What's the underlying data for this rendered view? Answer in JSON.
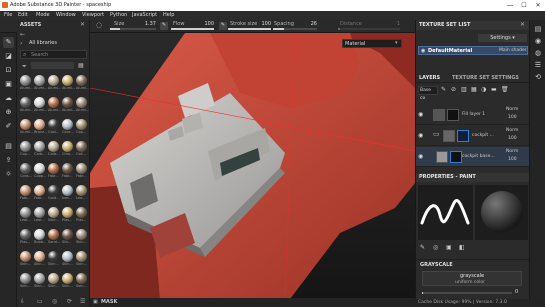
{
  "titlebar": {
    "title": "Adobe Substance 3D Painter - spaceship",
    "controls": [
      "—",
      "☐",
      "✕"
    ]
  },
  "menubar": {
    "items": [
      "File",
      "Edit",
      "Mode",
      "Window",
      "Viewport",
      "Python",
      "JavaScript",
      "Help"
    ]
  },
  "toolbar": {
    "size_label": "Size",
    "size_value": "1.37",
    "flow_label": "Flow",
    "flow_value": "100",
    "stroke_label": "Stroke size",
    "stroke_value": "100",
    "spacing_label": "Spacing",
    "spacing_value": "26",
    "distance_label": "Distance",
    "distance_value": "1"
  },
  "assets": {
    "title": "ASSETS",
    "library": "All libraries",
    "search_placeholder": "Search",
    "materials": [
      "Alumi...",
      "Alumi...",
      "Alumi...",
      "Alumi...",
      "Alumi...",
      "Alumi...",
      "Alumi...",
      "Alumi...",
      "Alumi...",
      "Alumi...",
      "Alumi...",
      "Bronz...",
      "Coal...",
      "Conc...",
      "Cop...",
      "Cop...",
      "Carb...",
      "Carb...",
      "Chro...",
      "Coll...",
      "Cons...",
      "Copp...",
      "Fabr...",
      "Fabr...",
      "Fabr...",
      "Fabr...",
      "Fabr...",
      "Gold...",
      "Iron...",
      "Lea...",
      "Leat...",
      "Leat...",
      "Nick...",
      "Plas...",
      "Plas...",
      "Plas...",
      "Rubb...",
      "Sand...",
      "Silv...",
      "Skin...",
      "Skin...",
      "Skin...",
      "Skin...",
      "Skin...",
      "Skin...",
      "Skin...",
      "Skin...",
      "Skin...",
      "Skin...",
      "Skin..."
    ]
  },
  "viewport": {
    "material_select": "Material",
    "mask_label": "MASK"
  },
  "texture_set_list": {
    "title": "TEXTURE SET LIST",
    "settings_label": "Settings",
    "item_name": "DefaultMaterial",
    "item_shader": "Main shader"
  },
  "layers": {
    "title": "LAYERS",
    "tab2": "TEXTURE SET SETTINGS",
    "channel": "Base co",
    "rows": [
      {
        "name": "Fill layer 1",
        "blend": "Norm",
        "opacity": "100"
      },
      {
        "name": "cockpit ...",
        "blend": "Norm",
        "opacity": "100"
      },
      {
        "name": "cockpit base...",
        "blend": "Norm",
        "opacity": "100"
      }
    ]
  },
  "properties": {
    "title": "PROPERTIES - PAINT",
    "grayscale_header": "GRAYSCALE",
    "grayscale_name": "grayscale",
    "grayscale_sub": "uniform color",
    "value": "0"
  },
  "status": {
    "text": "Cache Disk Usage:  99% | Version: 7.3.0"
  },
  "colors": {
    "accent": "#2f7fd6",
    "hull_red": "#c9483a",
    "hull_white": "#bdbdbd",
    "titlebar": "#ffffff"
  }
}
